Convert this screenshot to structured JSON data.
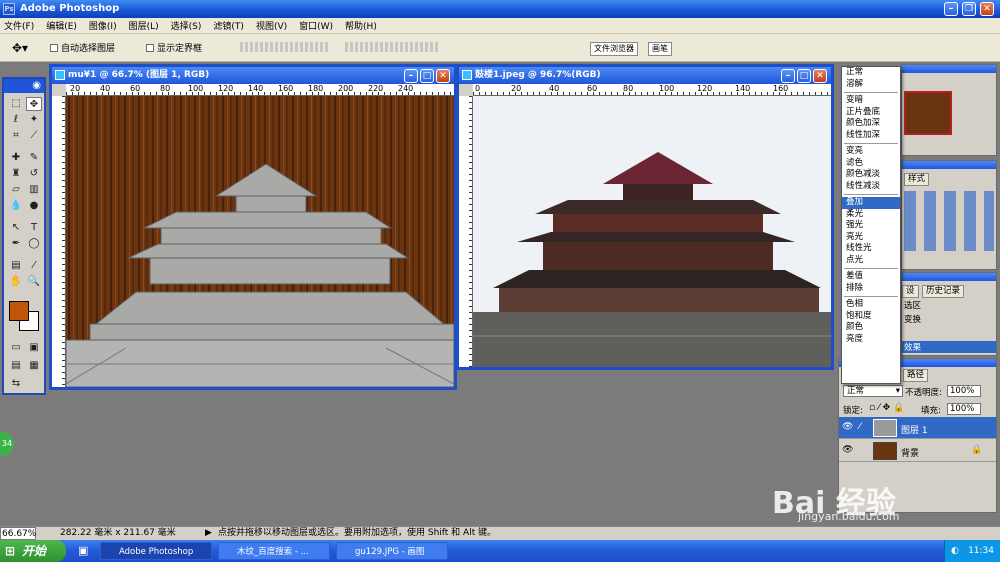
{
  "app": {
    "title": "Adobe Photoshop",
    "logo": "Ps"
  },
  "menu": [
    "文件(F)",
    "编辑(E)",
    "图像(I)",
    "图层(L)",
    "选择(S)",
    "滤镜(T)",
    "视图(V)",
    "窗口(W)",
    "帮助(H)"
  ],
  "options": {
    "auto_select": "自动选择图层",
    "show_bounds": "显示定界框",
    "tab_browser": "文件浏览器",
    "tab_brush": "画笔"
  },
  "doc1": {
    "title": "mu¥1 @ 66.7% (图层 1, RGB)",
    "ruler": [
      "20",
      "40",
      "60",
      "80",
      "100",
      "120",
      "140",
      "160",
      "180",
      "200",
      "220",
      "240"
    ]
  },
  "doc2": {
    "title": "鼓楼1.jpeg @ 96.7%(RGB)",
    "ruler": [
      "0",
      "20",
      "40",
      "60",
      "80",
      "100",
      "120",
      "140",
      "160"
    ]
  },
  "blend_modes": {
    "groups": [
      [
        "正常",
        "溶解"
      ],
      [
        "变暗",
        "正片叠底",
        "颜色加深",
        "线性加深"
      ],
      [
        "变亮",
        "滤色",
        "颜色减淡",
        "线性减淡"
      ],
      [
        "叠加",
        "柔光",
        "强光",
        "亮光",
        "线性光",
        "点光"
      ],
      [
        "差值",
        "排除"
      ],
      [
        "色相",
        "饱和度",
        "颜色",
        "亮度"
      ]
    ],
    "selected": "叠加"
  },
  "panels": {
    "styles_tab": "样式",
    "history_tab": "历史记录",
    "history_item1": "选区",
    "history_item2": "变换",
    "history_item3": "效果",
    "paths_tab": "路径",
    "set_tab": "设"
  },
  "layers": {
    "mode": "正常",
    "opacity_label": "不透明度:",
    "opacity": "100%",
    "lock_label": "锁定:",
    "fill_label": "填充:",
    "fill": "100%",
    "rows": [
      {
        "name": "图层 1",
        "selected": true
      },
      {
        "name": "背景",
        "selected": false
      }
    ]
  },
  "status": {
    "zoom": "66.67%",
    "size": "282.22 毫米 x 211.67 毫米",
    "hint": "点按并拖移以移动图层或选区。要用附加选项，使用 Shift 和 Alt 键。"
  },
  "taskbar": {
    "start": "开始",
    "items": [
      "Adobe Photoshop",
      "木纹_百度搜索 - ...",
      "gu129.JPG - 画图"
    ],
    "time": "11:34"
  },
  "watermark": {
    "brand": "Bai 经验",
    "url": "jingyan.baidu.com"
  },
  "colors": {
    "accent": "#1f56d9",
    "foreground": "#c0560a",
    "selection": "#316ac5"
  },
  "side_badge": "34"
}
